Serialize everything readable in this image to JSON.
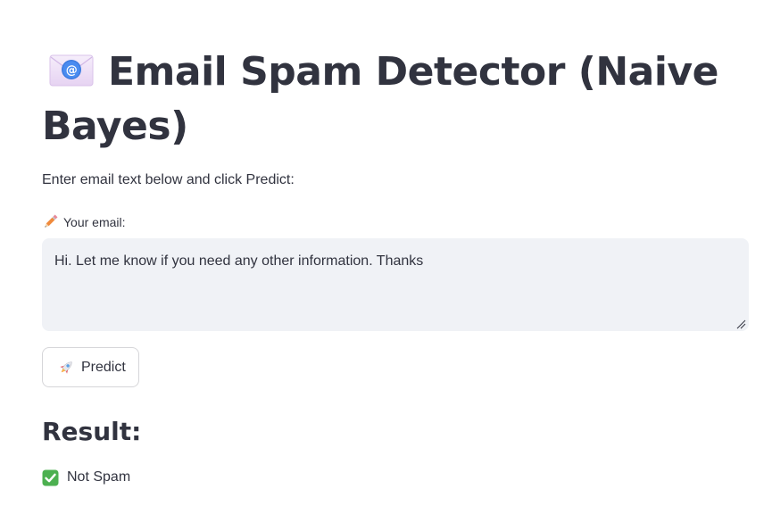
{
  "header": {
    "icon": "email-envelope-icon",
    "title": "Email Spam Detector (Naive Bayes)"
  },
  "intro_text": "Enter email text below and click Predict:",
  "email_field": {
    "icon": "pencil-icon",
    "label": "Your email:",
    "value": "Hi. Let me know if you need any other information. Thanks"
  },
  "predict_button": {
    "icon": "rocket-icon",
    "label": "Predict"
  },
  "result": {
    "heading": "Result:",
    "icon": "check-mark-icon",
    "text": "Not Spam"
  },
  "colors": {
    "text": "#31333f",
    "input_background": "#f0f2f6",
    "button_border": "#d6d6d9",
    "check_green": "#4cb050"
  }
}
